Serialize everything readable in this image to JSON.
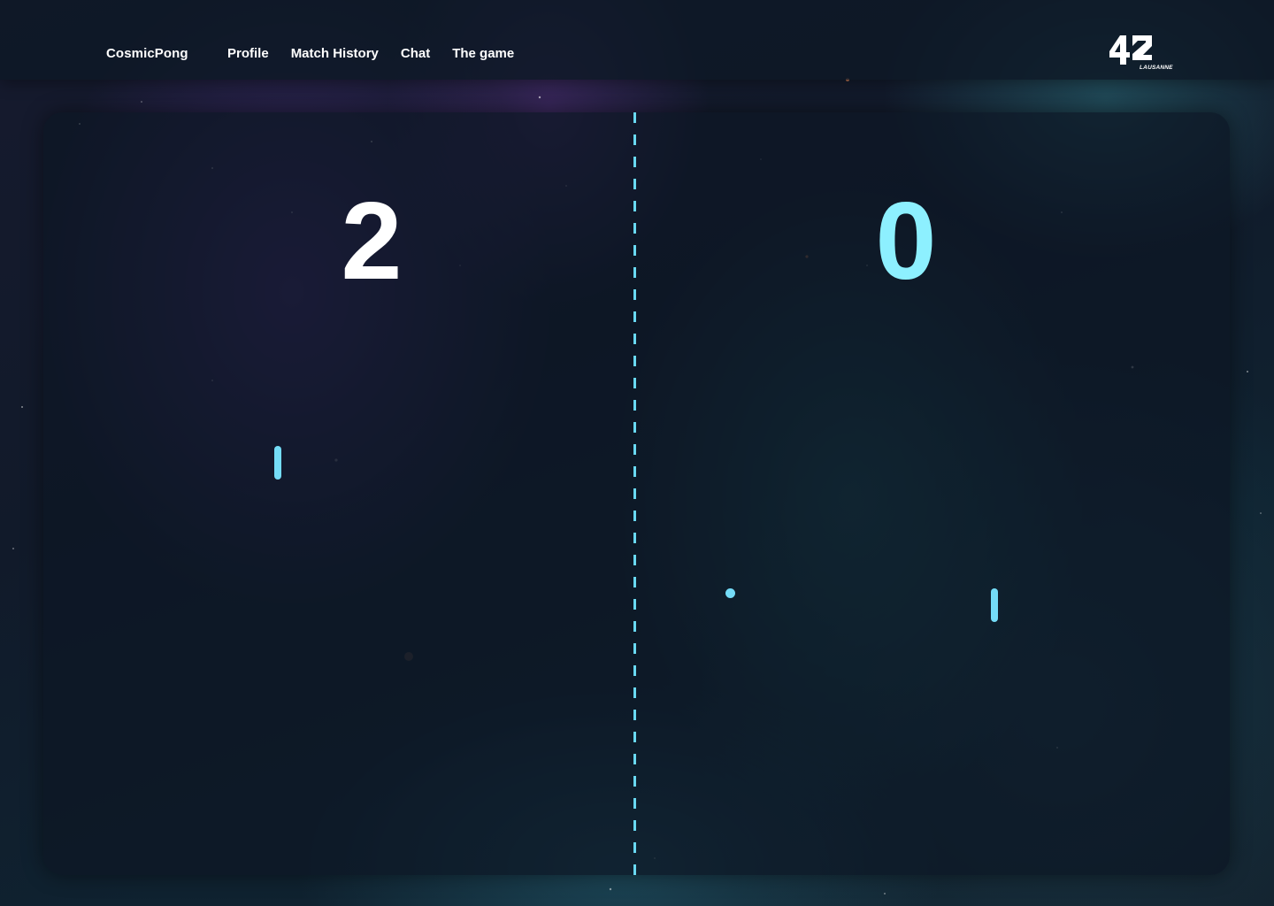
{
  "navbar": {
    "brand": "CosmicPong",
    "links": [
      {
        "label": "Profile"
      },
      {
        "label": "Match History"
      },
      {
        "label": "Chat"
      },
      {
        "label": "The game"
      }
    ],
    "logo": {
      "main": "42",
      "sub": "LAUSANNE"
    }
  },
  "game": {
    "score_left": "2",
    "score_right": "0"
  },
  "colors": {
    "accent": "#74dcf7",
    "score_right": "#8df0ff",
    "score_left": "#ffffff",
    "navbar_bg": "#0e1826"
  }
}
